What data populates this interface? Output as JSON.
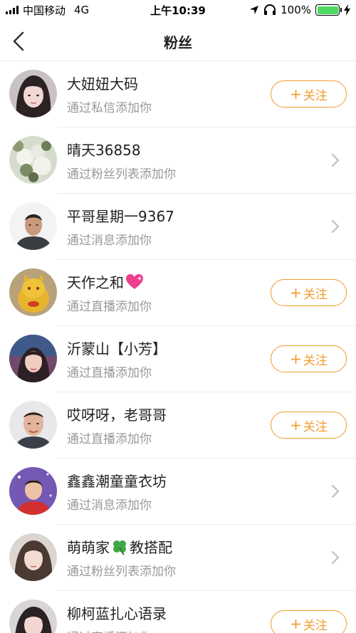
{
  "status_bar": {
    "carrier": "中国移动",
    "network": "4G",
    "time": "上午10:39",
    "battery": "100%",
    "battery_level": 1.0,
    "battery_color": "#4cd964"
  },
  "nav": {
    "title": "粉丝",
    "back_icon": "chevron-left-icon"
  },
  "accent_color": "#f39c2c",
  "followers": [
    {
      "name": "大妞妞大码",
      "name_suffix_icon": "",
      "source": "通过私信添加你",
      "action": "follow",
      "follow_plus": "+",
      "follow_label": "关注"
    },
    {
      "name": "晴天36858",
      "name_suffix_icon": "",
      "source": "通过粉丝列表添加你",
      "action": "chevron"
    },
    {
      "name": "平哥星期一9367",
      "name_suffix_icon": "",
      "source": "通过消息添加你",
      "action": "chevron"
    },
    {
      "name": "天作之和",
      "name_suffix_icon": "sparkling-heart-icon",
      "source": "通过直播添加你",
      "action": "follow",
      "follow_plus": "+",
      "follow_label": "关注"
    },
    {
      "name": "沂蒙山【小芳】",
      "name_suffix_icon": "",
      "source": "通过直播添加你",
      "action": "follow",
      "follow_plus": "+",
      "follow_label": "关注"
    },
    {
      "name": "哎呀呀，老哥哥",
      "name_suffix_icon": "",
      "source": "通过直播添加你",
      "action": "follow",
      "follow_plus": "+",
      "follow_label": "关注"
    },
    {
      "name": "鑫鑫潮童童衣坊",
      "name_suffix_icon": "",
      "source": "通过消息添加你",
      "action": "chevron"
    },
    {
      "name_part1": "萌萌家",
      "name_suffix_icon": "clover-icon",
      "name_part2": "教搭配",
      "source": "通过粉丝列表添加你",
      "action": "chevron"
    },
    {
      "name": "柳柯蓝扎心语录",
      "name_suffix_icon": "",
      "source": "通过直播添加你",
      "action": "follow",
      "follow_plus": "+",
      "follow_label": "关注"
    }
  ]
}
